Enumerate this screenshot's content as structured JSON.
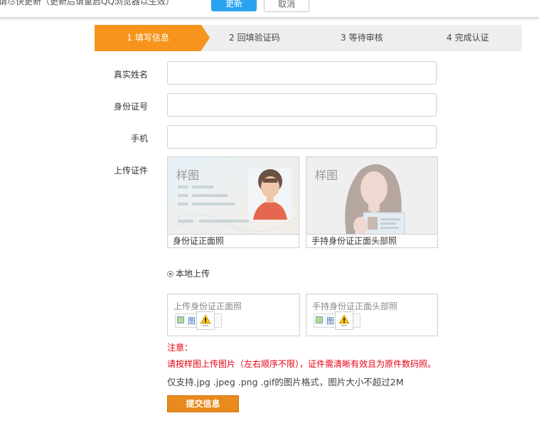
{
  "topbar": {
    "notice": "请尽快更新（更新后请重启QQ浏览器以生效）",
    "update_label": "更新",
    "cancel_label": "取消"
  },
  "steps": [
    {
      "num": "1",
      "label": "填写信息"
    },
    {
      "num": "2",
      "label": "回填验证码"
    },
    {
      "num": "3",
      "label": "等待审核"
    },
    {
      "num": "4",
      "label": "完成认证"
    }
  ],
  "form": {
    "name_label": "真实姓名",
    "id_label": "身份证号",
    "phone_label": "手机",
    "upload_label": "上传证件"
  },
  "samples": {
    "tag": "样图",
    "front_caption": "身份证正面照",
    "hold_caption": "手持身份证正面头部照"
  },
  "radio": {
    "label": "本地上传"
  },
  "upload": {
    "front_title": "上传身份证正面照",
    "hold_title": "手持身份证正面头部照",
    "ctrl_text": "图"
  },
  "notes": {
    "title": "注意：",
    "line1": "请按样图上传图片（左右顺序不限），证件需清晰有效且为原件数码照。",
    "line2": "仅支持.jpg .jpeg .png .gif的图片格式，图片大小不超过2M"
  },
  "submit_label": "提交信息",
  "colors": {
    "accent": "#f7941d",
    "update_btn": "#2aa3ef",
    "warning_text": "#e60012",
    "submit_btn": "#e88a1d"
  }
}
